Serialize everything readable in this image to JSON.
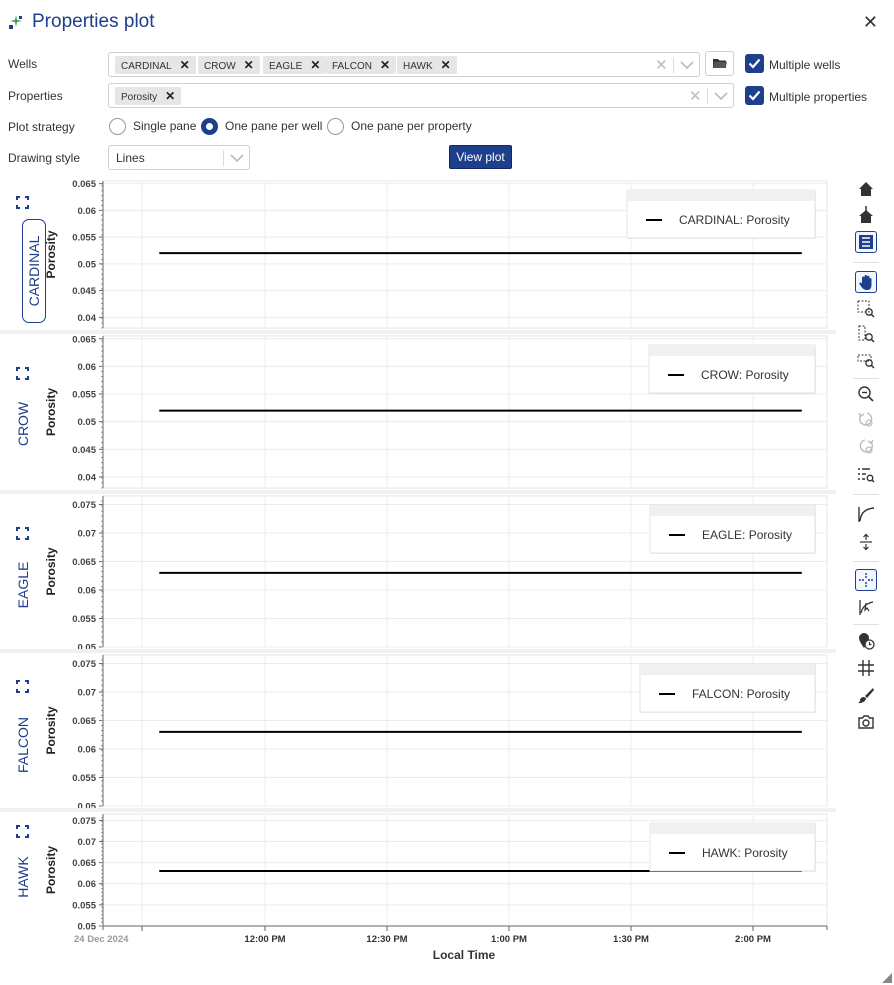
{
  "window": {
    "title": "Properties plot"
  },
  "wells_field": {
    "label": "Wells",
    "chips": [
      "CARDINAL",
      "CROW",
      "EAGLE",
      "FALCON",
      "HAWK"
    ]
  },
  "properties_field": {
    "label": "Properties",
    "chips": [
      "Porosity"
    ]
  },
  "multiple_wells": {
    "label": "Multiple wells",
    "checked": true
  },
  "multiple_properties": {
    "label": "Multiple properties",
    "checked": true
  },
  "plot_strategy": {
    "label": "Plot strategy",
    "options": [
      "Single pane",
      "One pane per well",
      "One pane per property"
    ],
    "selected": "One pane per well"
  },
  "drawing_style": {
    "label": "Drawing style",
    "value": "Lines"
  },
  "view_plot_button": "View plot",
  "colors": {
    "accent": "#1d3f8c",
    "line": "#000000",
    "grid": "#ececec"
  },
  "chart_data": [
    {
      "type": "line",
      "well": "CARDINAL",
      "ylabel": "Porosity",
      "yticks": [
        "0.065",
        "0.06",
        "0.055",
        "0.05",
        "0.045",
        "0.04"
      ],
      "ylim": [
        0.038,
        0.0655
      ],
      "series": [
        {
          "name": "CARDINAL: Porosity",
          "x": [
            "11:34 AM",
            "2:12 PM"
          ],
          "y": [
            0.052,
            0.052
          ]
        }
      ],
      "legend": "top-right"
    },
    {
      "type": "line",
      "well": "CROW",
      "ylabel": "Porosity",
      "yticks": [
        "0.065",
        "0.06",
        "0.055",
        "0.05",
        "0.045",
        "0.04"
      ],
      "ylim": [
        0.038,
        0.0655
      ],
      "series": [
        {
          "name": "CROW: Porosity",
          "x": [
            "11:34 AM",
            "2:12 PM"
          ],
          "y": [
            0.052,
            0.052
          ]
        }
      ],
      "legend": "top-right"
    },
    {
      "type": "line",
      "well": "EAGLE",
      "ylabel": "Porosity",
      "yticks": [
        "0.075",
        "0.07",
        "0.065",
        "0.06",
        "0.055",
        "0.05"
      ],
      "ylim": [
        0.05,
        0.0765
      ],
      "series": [
        {
          "name": "EAGLE: Porosity",
          "x": [
            "11:34 AM",
            "2:12 PM"
          ],
          "y": [
            0.063,
            0.063
          ]
        }
      ],
      "legend": "top-right"
    },
    {
      "type": "line",
      "well": "FALCON",
      "ylabel": "Porosity",
      "yticks": [
        "0.075",
        "0.07",
        "0.065",
        "0.06",
        "0.055",
        "0.05"
      ],
      "ylim": [
        0.05,
        0.0765
      ],
      "series": [
        {
          "name": "FALCON: Porosity",
          "x": [
            "11:34 AM",
            "2:12 PM"
          ],
          "y": [
            0.063,
            0.063
          ]
        }
      ],
      "legend": "top-right"
    },
    {
      "type": "line",
      "well": "HAWK",
      "ylabel": "Porosity",
      "yticks": [
        "0.075",
        "0.07",
        "0.065",
        "0.06",
        "0.055",
        "0.05"
      ],
      "ylim": [
        0.05,
        0.0765
      ],
      "series": [
        {
          "name": "HAWK: Porosity",
          "x": [
            "11:34 AM",
            "2:12 PM"
          ],
          "y": [
            0.063,
            0.063
          ]
        }
      ],
      "legend": "top-right"
    }
  ],
  "x_axis": {
    "label": "Local Time",
    "date_label": "24 Dec 2024",
    "ticks": [
      "12:00 PM",
      "12:30 PM",
      "1:00 PM",
      "1:30 PM",
      "2:00 PM"
    ]
  },
  "toolbar_icons": [
    "home-icon",
    "reset-axes-icon",
    "legend-toggle-icon",
    "pan-icon",
    "box-zoom-icon",
    "y-zoom-icon",
    "x-zoom-icon",
    "zoom-out-icon",
    "undo-zoom-icon",
    "redo-zoom-icon",
    "zoom-list-icon",
    "curve-icon",
    "spacing-icon",
    "crosshair-icon",
    "trace-icon",
    "pin-time-icon",
    "grid-icon",
    "paint-brush-icon",
    "camera-icon"
  ]
}
